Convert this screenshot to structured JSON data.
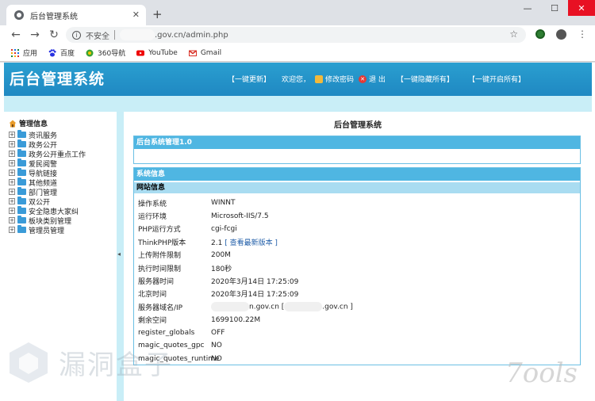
{
  "browser": {
    "tab_title": "后台管理系统",
    "address": {
      "security": "不安全",
      "url": ".gov.cn/admin.php"
    },
    "bookmarks": [
      {
        "label": "应用",
        "icon": "apps-grid-icon"
      },
      {
        "label": "百度",
        "icon": "baidu-paw-icon"
      },
      {
        "label": "360导航",
        "icon": "360-icon"
      },
      {
        "label": "YouTube",
        "icon": "youtube-icon"
      },
      {
        "label": "Gmail",
        "icon": "gmail-icon"
      }
    ]
  },
  "header": {
    "logo": "后台管理系统",
    "nav": {
      "refresh": "【一键更新】",
      "welcome": "欢迎您，",
      "change_password": "修改密码",
      "logout": "退 出",
      "hide_all": "【一键隐藏所有】",
      "show_all": "【一键开启所有】"
    }
  },
  "sidebar": {
    "root": "管理信息",
    "items": [
      "资讯服务",
      "政务公开",
      "政务公开重点工作",
      "爱民阅警",
      "导航链接",
      "其他频道",
      "部门管理",
      "双公开",
      "安全隐患大家纠",
      "板块类别管理",
      "管理员管理"
    ]
  },
  "main": {
    "title": "后台管理系统",
    "box1_title": "后台系统管理1.0",
    "system_info": "系统信息",
    "site_info": "网站信息",
    "rows": [
      {
        "k": "操作系统",
        "v": "WINNT"
      },
      {
        "k": "运行环境",
        "v": "Microsoft-IIS/7.5"
      },
      {
        "k": "PHP运行方式",
        "v": "cgi-fcgi"
      },
      {
        "k": "ThinkPHP版本",
        "v": "2.1",
        "link": "[ 查看最新版本 ]"
      },
      {
        "k": "上传附件限制",
        "v": "200M"
      },
      {
        "k": "执行时间限制",
        "v": "180秒"
      },
      {
        "k": "服务器时间",
        "v": "2020年3月14日 17:25:09"
      },
      {
        "k": "北京时间",
        "v": "2020年3月14日 17:25:09"
      },
      {
        "k": "服务器域名/IP",
        "v": "n.gov.cn [",
        "v2": ".gov.cn ]"
      },
      {
        "k": "剩余空间",
        "v": "1699100.22M"
      },
      {
        "k": "register_globals",
        "v": "OFF"
      },
      {
        "k": "magic_quotes_gpc",
        "v": "NO"
      },
      {
        "k": "magic_quotes_runtime",
        "v": "NO"
      }
    ]
  },
  "watermarks": {
    "left": "漏洞盒子",
    "right": "7ools"
  }
}
